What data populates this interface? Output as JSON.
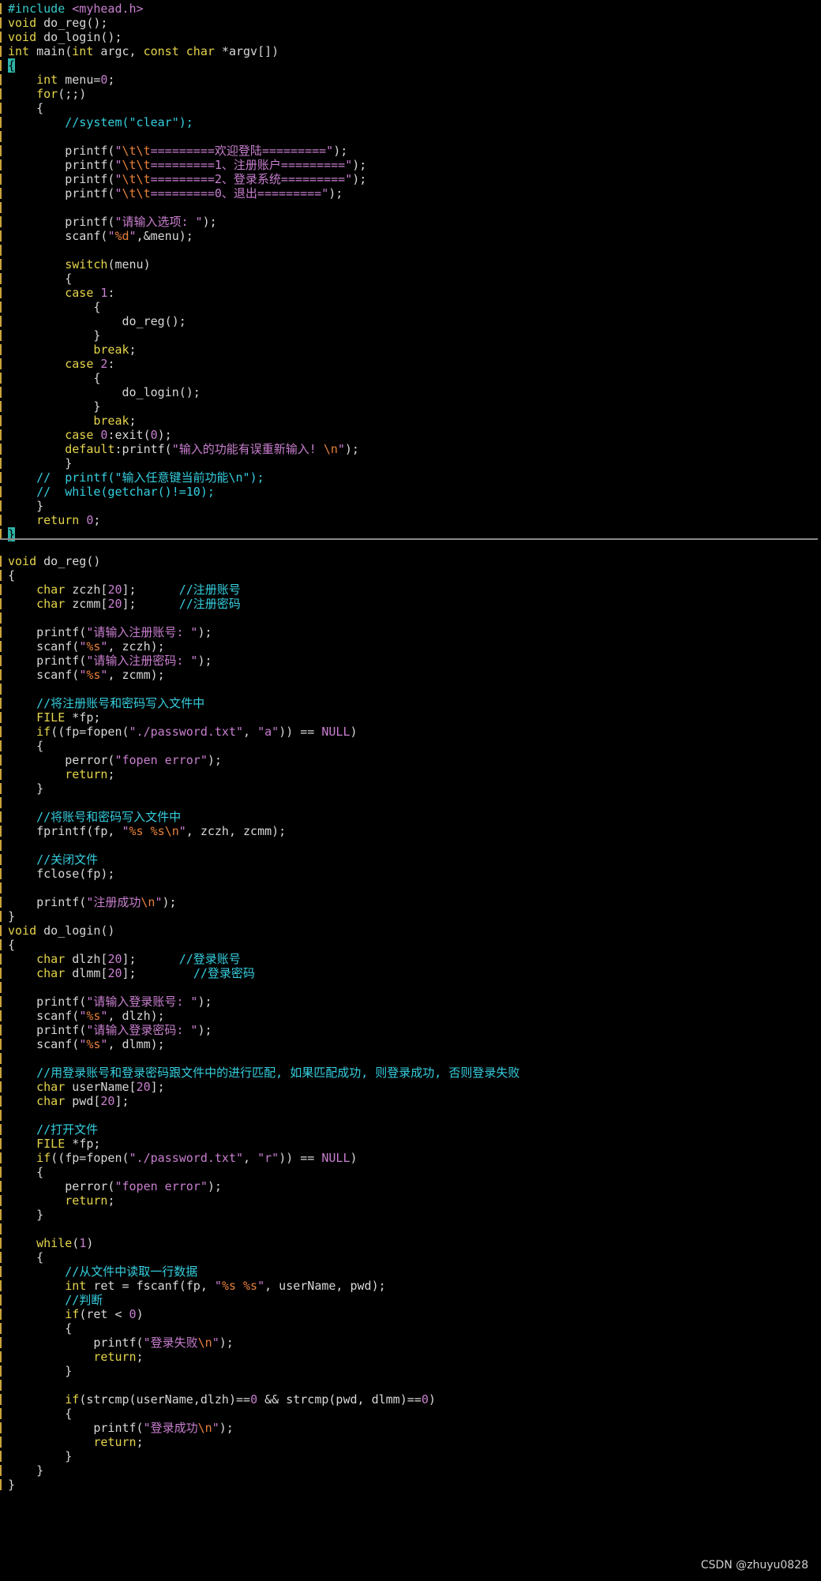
{
  "editor": {
    "theme": {
      "background": "#000000",
      "text": "#d8d8d8",
      "keyword": "#e5d44b",
      "preprocessor": "#39c9c9",
      "string": "#c97fd0",
      "comment": "#35cfe0",
      "escape": "#e8803a",
      "cursor": "#2fb4a8",
      "split_line": "#8a8a8a"
    },
    "top_pane": [
      [
        [
          "p",
          "#include "
        ],
        [
          "s",
          "<myhead.h>"
        ]
      ],
      [
        [
          "t",
          "void"
        ],
        [
          "x",
          " do_reg();"
        ]
      ],
      [
        [
          "t",
          "void"
        ],
        [
          "x",
          " do_login();"
        ]
      ],
      [
        [
          "t",
          "int"
        ],
        [
          "x",
          " main("
        ],
        [
          "t",
          "int"
        ],
        [
          "x",
          " argc, "
        ],
        [
          "t",
          "const"
        ],
        [
          "x",
          " "
        ],
        [
          "t",
          "char"
        ],
        [
          "x",
          " *argv[])"
        ]
      ],
      [
        [
          "cur",
          "{"
        ]
      ],
      [
        [
          "x",
          "    "
        ],
        [
          "t",
          "int"
        ],
        [
          "x",
          " menu="
        ],
        [
          "n",
          "0"
        ],
        [
          "x",
          ";"
        ]
      ],
      [
        [
          "x",
          "    "
        ],
        [
          "k",
          "for"
        ],
        [
          "x",
          "(;;)"
        ]
      ],
      [
        [
          "x",
          "    {"
        ]
      ],
      [
        [
          "c",
          "        //system(\"clear\");"
        ]
      ],
      [
        [
          "x",
          ""
        ]
      ],
      [
        [
          "x",
          "        printf("
        ],
        [
          "s",
          "\""
        ],
        [
          "e",
          "\\t\\t"
        ],
        [
          "s",
          "=========欢迎登陆=========\""
        ],
        [
          "x",
          ");"
        ]
      ],
      [
        [
          "x",
          "        printf("
        ],
        [
          "s",
          "\""
        ],
        [
          "e",
          "\\t\\t"
        ],
        [
          "s",
          "=========1、注册账户=========\""
        ],
        [
          "x",
          ");"
        ]
      ],
      [
        [
          "x",
          "        printf("
        ],
        [
          "s",
          "\""
        ],
        [
          "e",
          "\\t\\t"
        ],
        [
          "s",
          "=========2、登录系统=========\""
        ],
        [
          "x",
          ");"
        ]
      ],
      [
        [
          "x",
          "        printf("
        ],
        [
          "s",
          "\""
        ],
        [
          "e",
          "\\t\\t"
        ],
        [
          "s",
          "=========0、退出=========\""
        ],
        [
          "x",
          ");"
        ]
      ],
      [
        [
          "x",
          ""
        ]
      ],
      [
        [
          "x",
          "        printf("
        ],
        [
          "s",
          "\"请输入选项: \""
        ],
        [
          "x",
          ");"
        ]
      ],
      [
        [
          "x",
          "        scanf("
        ],
        [
          "s",
          "\""
        ],
        [
          "sp",
          "%d"
        ],
        [
          "s",
          "\""
        ],
        [
          "x",
          ",&menu);"
        ]
      ],
      [
        [
          "x",
          ""
        ]
      ],
      [
        [
          "x",
          "        "
        ],
        [
          "k",
          "switch"
        ],
        [
          "x",
          "(menu)"
        ]
      ],
      [
        [
          "x",
          "        {"
        ]
      ],
      [
        [
          "x",
          "        "
        ],
        [
          "k",
          "case"
        ],
        [
          "x",
          " "
        ],
        [
          "n",
          "1"
        ],
        [
          "x",
          ":"
        ]
      ],
      [
        [
          "x",
          "            {"
        ]
      ],
      [
        [
          "x",
          "                do_reg();"
        ]
      ],
      [
        [
          "x",
          "            }"
        ]
      ],
      [
        [
          "x",
          "            "
        ],
        [
          "k",
          "break"
        ],
        [
          "x",
          ";"
        ]
      ],
      [
        [
          "x",
          "        "
        ],
        [
          "k",
          "case"
        ],
        [
          "x",
          " "
        ],
        [
          "n",
          "2"
        ],
        [
          "x",
          ":"
        ]
      ],
      [
        [
          "x",
          "            {"
        ]
      ],
      [
        [
          "x",
          "                do_login();"
        ]
      ],
      [
        [
          "x",
          "            }"
        ]
      ],
      [
        [
          "x",
          "            "
        ],
        [
          "k",
          "break"
        ],
        [
          "x",
          ";"
        ]
      ],
      [
        [
          "x",
          "        "
        ],
        [
          "k",
          "case"
        ],
        [
          "x",
          " "
        ],
        [
          "n",
          "0"
        ],
        [
          "x",
          ":exit("
        ],
        [
          "n",
          "0"
        ],
        [
          "x",
          ");"
        ]
      ],
      [
        [
          "x",
          "        "
        ],
        [
          "k",
          "default"
        ],
        [
          "x",
          ":printf("
        ],
        [
          "s",
          "\"输入的功能有误重新输入! "
        ],
        [
          "e",
          "\\n"
        ],
        [
          "s",
          "\""
        ],
        [
          "x",
          ");"
        ]
      ],
      [
        [
          "x",
          "        }"
        ]
      ],
      [
        [
          "c",
          "    //  printf(\"输入任意键当前功能\\n\");"
        ]
      ],
      [
        [
          "c",
          "    //  while(getchar()!=10);"
        ]
      ],
      [
        [
          "x",
          "    }"
        ]
      ],
      [
        [
          "x",
          "    "
        ],
        [
          "k",
          "return"
        ],
        [
          "x",
          " "
        ],
        [
          "n",
          "0"
        ],
        [
          "x",
          ";"
        ]
      ],
      [
        [
          "cur",
          "}"
        ]
      ]
    ],
    "bottom_pane": [
      [
        [
          "t",
          "void"
        ],
        [
          "x",
          " do_reg()"
        ]
      ],
      [
        [
          "x",
          "{"
        ]
      ],
      [
        [
          "x",
          "    "
        ],
        [
          "t",
          "char"
        ],
        [
          "x",
          " zczh["
        ],
        [
          "n",
          "20"
        ],
        [
          "x",
          "];      "
        ],
        [
          "c",
          "//注册账号"
        ]
      ],
      [
        [
          "x",
          "    "
        ],
        [
          "t",
          "char"
        ],
        [
          "x",
          " zcmm["
        ],
        [
          "n",
          "20"
        ],
        [
          "x",
          "];      "
        ],
        [
          "c",
          "//注册密码"
        ]
      ],
      [
        [
          "x",
          ""
        ]
      ],
      [
        [
          "x",
          "    printf("
        ],
        [
          "s",
          "\"请输入注册账号: \""
        ],
        [
          "x",
          ");"
        ]
      ],
      [
        [
          "x",
          "    scanf("
        ],
        [
          "s",
          "\""
        ],
        [
          "sp",
          "%s"
        ],
        [
          "s",
          "\""
        ],
        [
          "x",
          ", zczh);"
        ]
      ],
      [
        [
          "x",
          "    printf("
        ],
        [
          "s",
          "\"请输入注册密码: \""
        ],
        [
          "x",
          ");"
        ]
      ],
      [
        [
          "x",
          "    scanf("
        ],
        [
          "s",
          "\""
        ],
        [
          "sp",
          "%s"
        ],
        [
          "s",
          "\""
        ],
        [
          "x",
          ", zcmm);"
        ]
      ],
      [
        [
          "x",
          ""
        ]
      ],
      [
        [
          "c",
          "    //将注册账号和密码写入文件中"
        ]
      ],
      [
        [
          "x",
          "    "
        ],
        [
          "t",
          "FILE"
        ],
        [
          "x",
          " *fp;"
        ]
      ],
      [
        [
          "x",
          "    "
        ],
        [
          "k",
          "if"
        ],
        [
          "x",
          "((fp=fopen("
        ],
        [
          "s",
          "\"./password.txt\""
        ],
        [
          "x",
          ", "
        ],
        [
          "s",
          "\"a\""
        ],
        [
          "x",
          ")) == "
        ],
        [
          "n",
          "NULL"
        ],
        [
          "x",
          ")"
        ]
      ],
      [
        [
          "x",
          "    {"
        ]
      ],
      [
        [
          "x",
          "        perror("
        ],
        [
          "s",
          "\"fopen error\""
        ],
        [
          "x",
          ");"
        ]
      ],
      [
        [
          "x",
          "        "
        ],
        [
          "k",
          "return"
        ],
        [
          "x",
          ";"
        ]
      ],
      [
        [
          "x",
          "    }"
        ]
      ],
      [
        [
          "x",
          ""
        ]
      ],
      [
        [
          "c",
          "    //将账号和密码写入文件中"
        ]
      ],
      [
        [
          "x",
          "    fprintf(fp, "
        ],
        [
          "s",
          "\""
        ],
        [
          "sp",
          "%s"
        ],
        [
          "s",
          " "
        ],
        [
          "sp",
          "%s"
        ],
        [
          "e",
          "\\n"
        ],
        [
          "s",
          "\""
        ],
        [
          "x",
          ", zczh, zcmm);"
        ]
      ],
      [
        [
          "x",
          ""
        ]
      ],
      [
        [
          "c",
          "    //关闭文件"
        ]
      ],
      [
        [
          "x",
          "    fclose(fp);"
        ]
      ],
      [
        [
          "x",
          ""
        ]
      ],
      [
        [
          "x",
          "    printf("
        ],
        [
          "s",
          "\"注册成功"
        ],
        [
          "e",
          "\\n"
        ],
        [
          "s",
          "\""
        ],
        [
          "x",
          ");"
        ]
      ],
      [
        [
          "x",
          "}"
        ]
      ],
      [
        [
          "t",
          "void"
        ],
        [
          "x",
          " do_login()"
        ]
      ],
      [
        [
          "x",
          "{"
        ]
      ],
      [
        [
          "x",
          "    "
        ],
        [
          "t",
          "char"
        ],
        [
          "x",
          " dlzh["
        ],
        [
          "n",
          "20"
        ],
        [
          "x",
          "];      "
        ],
        [
          "c",
          "//登录账号"
        ]
      ],
      [
        [
          "x",
          "    "
        ],
        [
          "t",
          "char"
        ],
        [
          "x",
          " dlmm["
        ],
        [
          "n",
          "20"
        ],
        [
          "x",
          "];        "
        ],
        [
          "c",
          "//登录密码"
        ]
      ],
      [
        [
          "x",
          ""
        ]
      ],
      [
        [
          "x",
          "    printf("
        ],
        [
          "s",
          "\"请输入登录账号: \""
        ],
        [
          "x",
          ");"
        ]
      ],
      [
        [
          "x",
          "    scanf("
        ],
        [
          "s",
          "\""
        ],
        [
          "sp",
          "%s"
        ],
        [
          "s",
          "\""
        ],
        [
          "x",
          ", dlzh);"
        ]
      ],
      [
        [
          "x",
          "    printf("
        ],
        [
          "s",
          "\"请输入登录密码: \""
        ],
        [
          "x",
          ");"
        ]
      ],
      [
        [
          "x",
          "    scanf("
        ],
        [
          "s",
          "\""
        ],
        [
          "sp",
          "%s"
        ],
        [
          "s",
          "\""
        ],
        [
          "x",
          ", dlmm);"
        ]
      ],
      [
        [
          "x",
          ""
        ]
      ],
      [
        [
          "c",
          "    //用登录账号和登录密码跟文件中的进行匹配, 如果匹配成功, 则登录成功, 否则登录失败"
        ]
      ],
      [
        [
          "x",
          "    "
        ],
        [
          "t",
          "char"
        ],
        [
          "x",
          " userName["
        ],
        [
          "n",
          "20"
        ],
        [
          "x",
          "];"
        ]
      ],
      [
        [
          "x",
          "    "
        ],
        [
          "t",
          "char"
        ],
        [
          "x",
          " pwd["
        ],
        [
          "n",
          "20"
        ],
        [
          "x",
          "];"
        ]
      ],
      [
        [
          "x",
          ""
        ]
      ],
      [
        [
          "c",
          "    //打开文件"
        ]
      ],
      [
        [
          "x",
          "    "
        ],
        [
          "t",
          "FILE"
        ],
        [
          "x",
          " *fp;"
        ]
      ],
      [
        [
          "x",
          "    "
        ],
        [
          "k",
          "if"
        ],
        [
          "x",
          "((fp=fopen("
        ],
        [
          "s",
          "\"./password.txt\""
        ],
        [
          "x",
          ", "
        ],
        [
          "s",
          "\"r\""
        ],
        [
          "x",
          ")) == "
        ],
        [
          "n",
          "NULL"
        ],
        [
          "x",
          ")"
        ]
      ],
      [
        [
          "x",
          "    {"
        ]
      ],
      [
        [
          "x",
          "        perror("
        ],
        [
          "s",
          "\"fopen error\""
        ],
        [
          "x",
          ");"
        ]
      ],
      [
        [
          "x",
          "        "
        ],
        [
          "k",
          "return"
        ],
        [
          "x",
          ";"
        ]
      ],
      [
        [
          "x",
          "    }"
        ]
      ],
      [
        [
          "x",
          ""
        ]
      ],
      [
        [
          "x",
          "    "
        ],
        [
          "k",
          "while"
        ],
        [
          "x",
          "("
        ],
        [
          "n",
          "1"
        ],
        [
          "x",
          ")"
        ]
      ],
      [
        [
          "x",
          "    {"
        ]
      ],
      [
        [
          "c",
          "        //从文件中读取一行数据"
        ]
      ],
      [
        [
          "x",
          "        "
        ],
        [
          "t",
          "int"
        ],
        [
          "x",
          " ret = fscanf(fp, "
        ],
        [
          "s",
          "\""
        ],
        [
          "sp",
          "%s"
        ],
        [
          "s",
          " "
        ],
        [
          "sp",
          "%s"
        ],
        [
          "s",
          "\""
        ],
        [
          "x",
          ", userName, pwd);"
        ]
      ],
      [
        [
          "c",
          "        //判断"
        ]
      ],
      [
        [
          "x",
          "        "
        ],
        [
          "k",
          "if"
        ],
        [
          "x",
          "(ret < "
        ],
        [
          "n",
          "0"
        ],
        [
          "x",
          ")"
        ]
      ],
      [
        [
          "x",
          "        {"
        ]
      ],
      [
        [
          "x",
          "            printf("
        ],
        [
          "s",
          "\"登录失败"
        ],
        [
          "e",
          "\\n"
        ],
        [
          "s",
          "\""
        ],
        [
          "x",
          ");"
        ]
      ],
      [
        [
          "x",
          "            "
        ],
        [
          "k",
          "return"
        ],
        [
          "x",
          ";"
        ]
      ],
      [
        [
          "x",
          "        }"
        ]
      ],
      [
        [
          "x",
          ""
        ]
      ],
      [
        [
          "x",
          "        "
        ],
        [
          "k",
          "if"
        ],
        [
          "x",
          "(strcmp(userName,dlzh)=="
        ],
        [
          "n",
          "0"
        ],
        [
          "x",
          " && strcmp(pwd, dlmm)=="
        ],
        [
          "n",
          "0"
        ],
        [
          "x",
          ")"
        ]
      ],
      [
        [
          "x",
          "        {"
        ]
      ],
      [
        [
          "x",
          "            printf("
        ],
        [
          "s",
          "\"登录成功"
        ],
        [
          "e",
          "\\n"
        ],
        [
          "s",
          "\""
        ],
        [
          "x",
          ");"
        ]
      ],
      [
        [
          "x",
          "            "
        ],
        [
          "k",
          "return"
        ],
        [
          "x",
          ";"
        ]
      ],
      [
        [
          "x",
          "        }"
        ]
      ],
      [
        [
          "x",
          "    }"
        ]
      ],
      [
        [
          "x",
          "}"
        ]
      ]
    ]
  },
  "watermark": {
    "text": "CSDN @zhuyu0828"
  }
}
